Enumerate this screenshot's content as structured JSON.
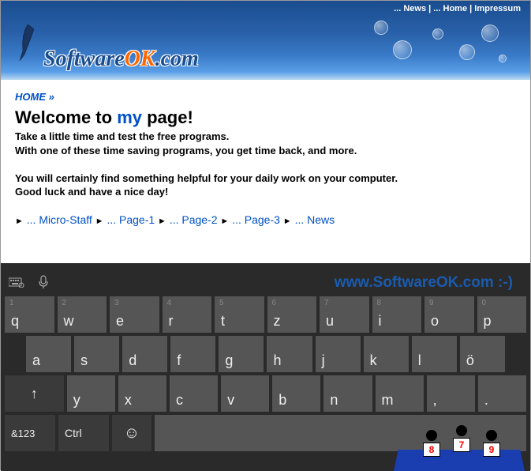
{
  "header": {
    "top_links": {
      "news": "... News",
      "home": "... Home",
      "impressum": "Impressum"
    },
    "logo": {
      "part1": "Software",
      "part2": "OK",
      "part3": ".com"
    }
  },
  "breadcrumb": {
    "home": "HOME",
    "sep": "»"
  },
  "heading": {
    "pre": "Welcome to ",
    "highlight": "my",
    "post": " page!"
  },
  "body": {
    "line1": "Take a little time and test the free programs.",
    "line2": "With one of these time saving programs, you get time back, and more.",
    "line3": "You will certainly find something helpful for your daily work on your computer.",
    "line4": "Good luck and have a nice day!"
  },
  "nav": {
    "arrow": "►",
    "items": [
      "... Micro-Staff",
      "... Page-1",
      "... Page-2",
      "... Page-3",
      "... News"
    ]
  },
  "url_overlay": "www.SoftwareOK.com :-)",
  "keyboard": {
    "row1_alt": [
      "1",
      "2",
      "3",
      "4",
      "5",
      "6",
      "7",
      "8",
      "9",
      "0"
    ],
    "row1": [
      "q",
      "w",
      "e",
      "r",
      "t",
      "z",
      "u",
      "i",
      "o",
      "p"
    ],
    "row2": [
      "a",
      "s",
      "d",
      "f",
      "g",
      "h",
      "j",
      "k",
      "l",
      "ö"
    ],
    "row3": [
      "y",
      "x",
      "c",
      "v",
      "b",
      "n",
      "m",
      ",",
      "."
    ],
    "shift": "↑",
    "sym": "&123",
    "ctrl": "Ctrl",
    "emoji": "☺"
  },
  "judges": [
    "8",
    "7",
    "9"
  ]
}
